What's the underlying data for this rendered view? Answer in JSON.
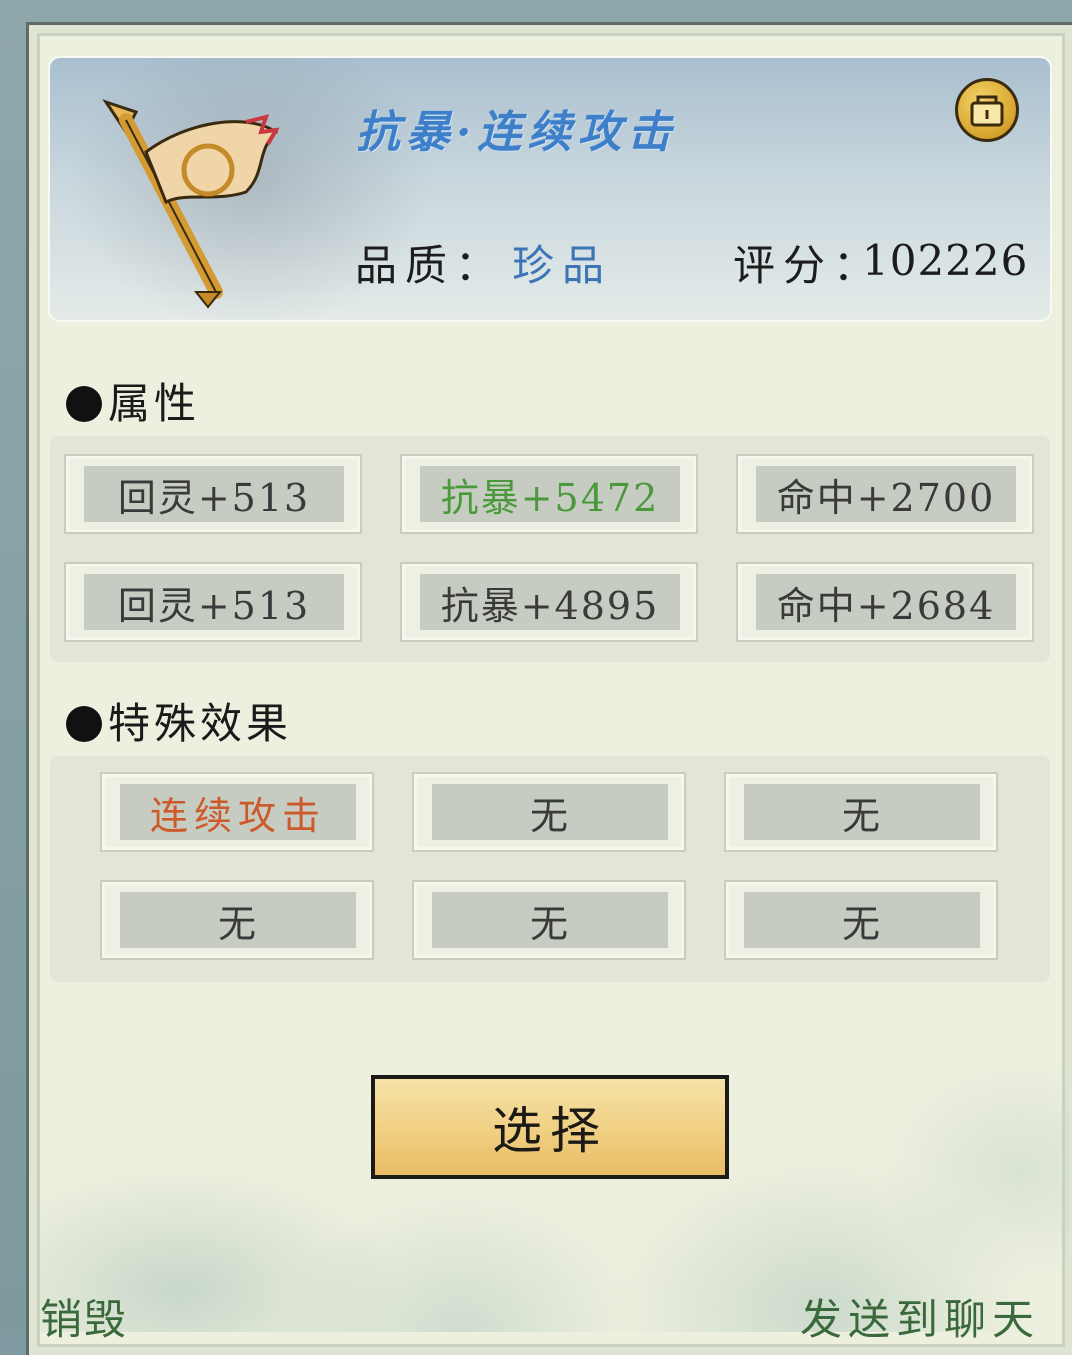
{
  "item": {
    "name": "抗暴·连续攻击",
    "quality_label": "品质：",
    "quality_value": "珍品",
    "score_label": "评分：",
    "score_value": "102226"
  },
  "attributes": {
    "title": "属性",
    "items": [
      "回灵+513",
      "抗暴+5472",
      "命中+2700",
      "回灵+513",
      "抗暴+4895",
      "命中+2684"
    ]
  },
  "special": {
    "title": "特殊效果",
    "items": [
      "连续攻击",
      "无",
      "无",
      "无",
      "无",
      "无"
    ]
  },
  "actions": {
    "select": "选择",
    "destroy": "销毁",
    "send_to_chat": "发送到聊天"
  },
  "icons": {
    "weapon": "banner-spear-icon",
    "lock": "lock-icon"
  },
  "colors": {
    "name": "#3e7fc9",
    "quality": "#3d74b6",
    "highlight_attr": "#4a9a3c",
    "active_special": "#cc5a2a",
    "button": "#f0cf82"
  }
}
